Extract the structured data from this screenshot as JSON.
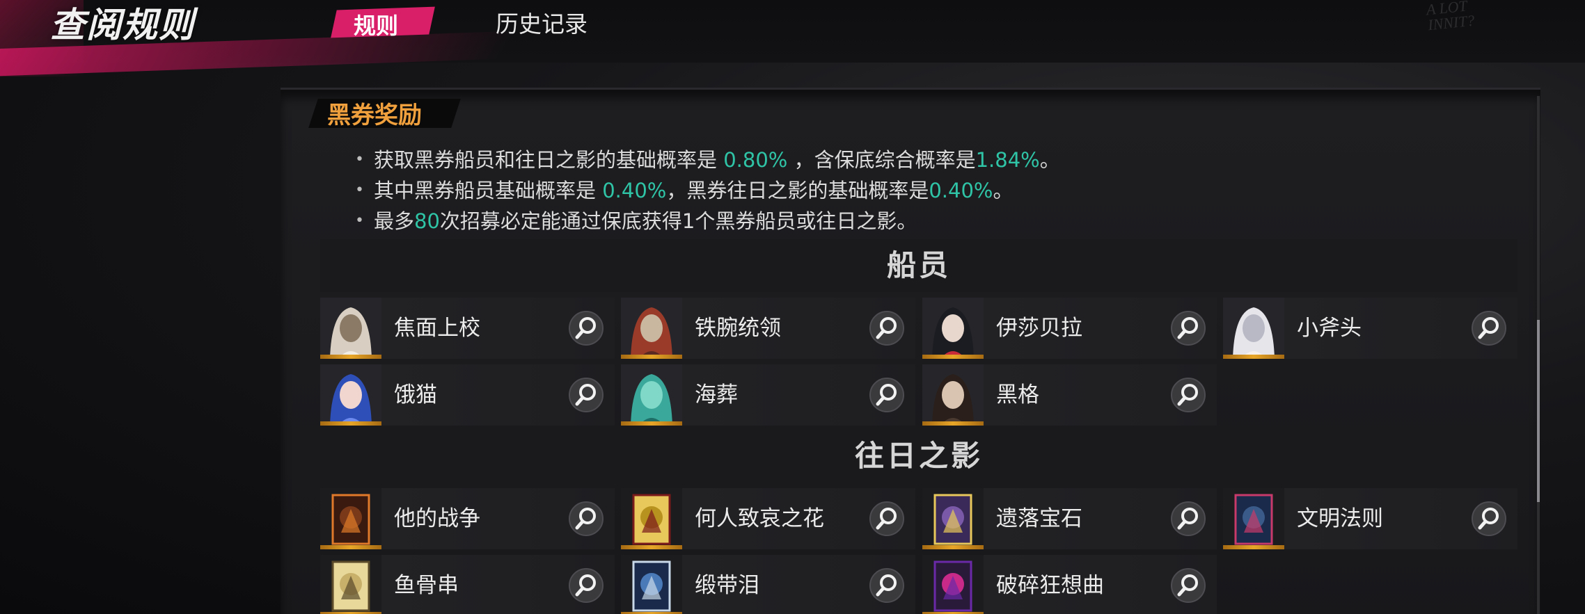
{
  "header": {
    "title": "查阅规则",
    "tabs": [
      {
        "label": "规则",
        "active": true
      },
      {
        "label": "历史记录",
        "active": false
      }
    ],
    "corner_mark": "A LOT\nINNIT?"
  },
  "section": {
    "title": "黑券奖励",
    "rules": [
      {
        "parts": [
          "获取黑券船员和往日之影的基础概率是 ",
          "0.80%",
          " ，含保底综合概率是",
          "1.84%",
          "。"
        ]
      },
      {
        "parts": [
          "其中黑券船员基础概率是 ",
          "0.40%",
          "，黑券往日之影的基础概率是",
          "0.40%",
          "。"
        ]
      },
      {
        "parts": [
          "最多",
          "80",
          "次招募必定能通过保底获得1个黑券船员或往日之影。"
        ]
      }
    ]
  },
  "groups": [
    {
      "title": "船员",
      "items": [
        {
          "name": "焦面上校",
          "portrait": "pale-long-hair-colonel"
        },
        {
          "name": "铁腕统领",
          "portrait": "armored-commander"
        },
        {
          "name": "伊莎贝拉",
          "portrait": "dark-haired-woman-red-flower"
        },
        {
          "name": "小斧头",
          "portrait": "white-haired-girl"
        },
        {
          "name": "饿猫",
          "portrait": "blue-haired-cat-girl"
        },
        {
          "name": "海葬",
          "portrait": "teal-sea-creature"
        },
        {
          "name": "黑格",
          "portrait": "long-haired-man"
        }
      ]
    },
    {
      "title": "往日之影",
      "items": [
        {
          "name": "他的战争",
          "portrait": "war-card"
        },
        {
          "name": "何人致哀之花",
          "portrait": "flower-card"
        },
        {
          "name": "遗落宝石",
          "portrait": "gem-card"
        },
        {
          "name": "文明法则",
          "portrait": "law-card"
        },
        {
          "name": "鱼骨串",
          "portrait": "fishbone-card"
        },
        {
          "name": "缎带泪",
          "portrait": "ribbon-card"
        },
        {
          "name": "破碎狂想曲",
          "portrait": "rhapsody-card"
        }
      ]
    }
  ],
  "colors": {
    "accent": "#d81f68",
    "section_title": "#f0a03c",
    "highlight": "#2fc4a6",
    "portrait_base": "#e8a628"
  }
}
